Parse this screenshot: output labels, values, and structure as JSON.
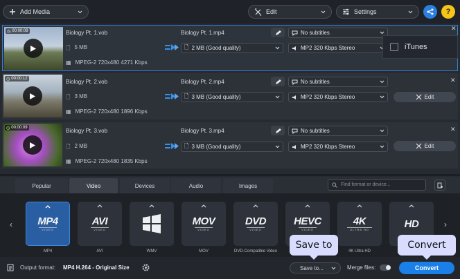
{
  "toolbar": {
    "add_media": "Add Media",
    "edit": "Edit",
    "settings": "Settings"
  },
  "files": [
    {
      "time": "00:00:09",
      "name": "Biology Pt. 1.vob",
      "size": "5 MB",
      "codec": "MPEG-2 720x480 4271 Kbps",
      "output_name": "Biology Pt. 1.mp4",
      "output_size": "2 MB (Good quality)",
      "subtitles": "No subtitles",
      "audio": "MP2 320 Kbps Stereo"
    },
    {
      "time": "00:00:12",
      "name": "Biology Pt. 2.vob",
      "size": "3 MB",
      "codec": "MPEG-2 720x480 1896 Kbps",
      "output_name": "Biology Pt. 2.mp4",
      "output_size": "3 MB (Good quality)",
      "subtitles": "No subtitles",
      "audio": "MP2 320 Kbps Stereo",
      "edit": "Edit"
    },
    {
      "time": "00:00:09",
      "name": "Biology Pt. 3.vob",
      "size": "2 MB",
      "codec": "MPEG-2 720x480 1835 Kbps",
      "output_name": "Biology Pt. 3.mp4",
      "output_size": "3 MB (Good quality)",
      "subtitles": "No subtitles",
      "audio": "MP2 320 Kbps Stereo",
      "edit": "Edit"
    }
  ],
  "itunes_label": "iTunes",
  "tabs": [
    "Popular",
    "Video",
    "Devices",
    "Audio",
    "Images"
  ],
  "active_tab": "Video",
  "search_placeholder": "Find format or device...",
  "formats": [
    {
      "logo": "MP4",
      "sub": "VIDEO",
      "label": "MP4"
    },
    {
      "logo": "AVI",
      "sub": "VIDEO",
      "label": "AVI"
    },
    {
      "logo": "",
      "sub": "",
      "label": "WMV",
      "icon": "windows-logo-icon"
    },
    {
      "logo": "MOV",
      "sub": "VIDEO",
      "label": "MOV"
    },
    {
      "logo": "DVD",
      "sub": "VIDEO",
      "label": "DVD-Compatible Video"
    },
    {
      "logo": "HEVC",
      "sub": "VIDEO",
      "label": ""
    },
    {
      "logo": "4K",
      "sub": "ULTRA HD",
      "label": "4K Ultra HD"
    },
    {
      "logo": "HD",
      "sub": "",
      "label": ""
    }
  ],
  "status": {
    "output_format_label": "Output format:",
    "output_format_value": "MP4 H.264 - Original Size",
    "save_to": "Save to...",
    "merge_files": "Merge files:",
    "convert": "Convert"
  },
  "tooltips": {
    "save_to": "Save to",
    "convert": "Convert"
  },
  "colors": {
    "accent": "#1a80e8",
    "selection_border": "#2f7fd8",
    "tooltip_bg": "#d9dcff"
  }
}
